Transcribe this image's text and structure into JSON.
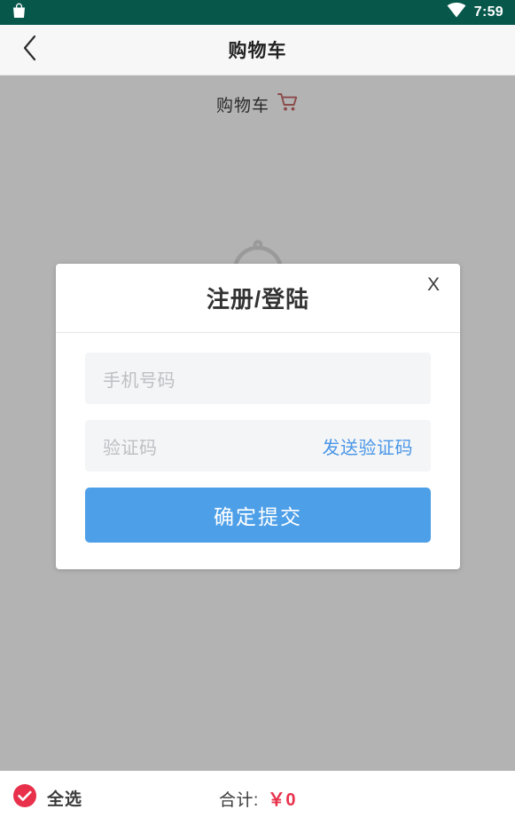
{
  "status_bar": {
    "notification_icon": "shopping-bag-icon",
    "wifi_icon": "wifi-icon",
    "time": "7:59",
    "background_color": "#07584b"
  },
  "header": {
    "back_icon": "chevron-left-icon",
    "title": "购物车"
  },
  "content": {
    "cart_label": "购物车",
    "cart_icon": "shopping-cart-icon",
    "cart_icon_color": "#8c4a4a",
    "empty_state_icon": "bell-icon",
    "background_color": "#b3b3b3"
  },
  "modal": {
    "title": "注册/登陆",
    "close_label": "X",
    "phone_field": {
      "placeholder": "手机号码",
      "value": ""
    },
    "code_field": {
      "placeholder": "验证码",
      "value": "",
      "send_code_label": "发送验证码",
      "send_code_color": "#4a97e8"
    },
    "submit_label": "确定提交",
    "submit_color": "#4d9fe8"
  },
  "bottom_bar": {
    "select_all_icon": "check-circle-icon",
    "select_all_label": "全选",
    "select_all_checked": true,
    "select_all_color": "#e8304a",
    "total_label": "合计:",
    "total_value": "￥0",
    "total_value_color": "#e8304a"
  }
}
